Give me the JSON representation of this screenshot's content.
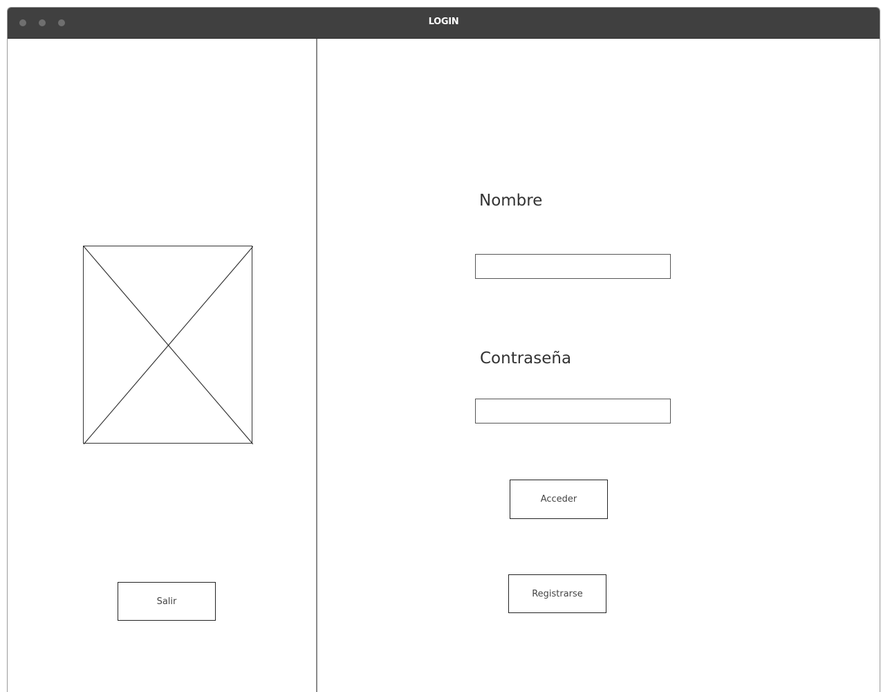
{
  "window": {
    "title": "LOGIN"
  },
  "left_panel": {
    "image_placeholder": "image-placeholder-icon",
    "exit_button_label": "Salir"
  },
  "form": {
    "name_label": "Nombre",
    "name_value": "",
    "name_placeholder": "",
    "password_label": "Contraseña",
    "password_value": "",
    "password_placeholder": "",
    "login_button_label": "Acceder",
    "register_button_label": "Registrarse"
  },
  "colors": {
    "titlebar": "#404040",
    "title_text": "#ffffff",
    "border": "#222222",
    "background": "#ffffff"
  }
}
